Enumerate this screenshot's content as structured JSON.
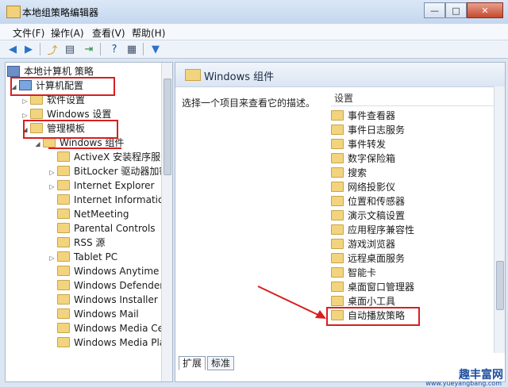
{
  "window": {
    "title": "本地组策略编辑器",
    "min": "—",
    "max": "□",
    "close": "✕"
  },
  "menu": [
    "文件(F)",
    "操作(A)",
    "查看(V)",
    "帮助(H)"
  ],
  "toolbar": [
    "back-icon",
    "forward-icon",
    "up-icon",
    "show-hide-tree-icon",
    "export-icon",
    "help-icon",
    "properties-icon",
    "filter-icon"
  ],
  "tree": [
    {
      "label": "本地计算机 策略",
      "level": 0,
      "icon": "gp",
      "expander": ""
    },
    {
      "label": "计算机配置",
      "level": 1,
      "icon": "pc",
      "expander": "◢"
    },
    {
      "label": "软件设置",
      "level": 2,
      "icon": "folder",
      "expander": "▷"
    },
    {
      "label": "Windows 设置",
      "level": 2,
      "icon": "folder",
      "expander": "▷"
    },
    {
      "label": "管理模板",
      "level": 2,
      "icon": "folder",
      "expander": "◢"
    },
    {
      "label": "Windows 组件",
      "level": 3,
      "icon": "folder",
      "expander": "◢"
    },
    {
      "label": "ActiveX 安装程序服务",
      "level": 4,
      "icon": "folder",
      "expander": ""
    },
    {
      "label": "BitLocker 驱动器加密",
      "level": 4,
      "icon": "folder",
      "expander": "▷"
    },
    {
      "label": "Internet Explorer",
      "level": 4,
      "icon": "folder",
      "expander": "▷"
    },
    {
      "label": "Internet Information",
      "level": 4,
      "icon": "folder",
      "expander": ""
    },
    {
      "label": "NetMeeting",
      "level": 4,
      "icon": "folder",
      "expander": ""
    },
    {
      "label": "Parental Controls",
      "level": 4,
      "icon": "folder",
      "expander": ""
    },
    {
      "label": "RSS 源",
      "level": 4,
      "icon": "folder",
      "expander": ""
    },
    {
      "label": "Tablet PC",
      "level": 4,
      "icon": "folder",
      "expander": "▷"
    },
    {
      "label": "Windows Anytime Up",
      "level": 4,
      "icon": "folder",
      "expander": ""
    },
    {
      "label": "Windows Defender",
      "level": 4,
      "icon": "folder",
      "expander": ""
    },
    {
      "label": "Windows Installer",
      "level": 4,
      "icon": "folder",
      "expander": ""
    },
    {
      "label": "Windows Mail",
      "level": 4,
      "icon": "folder",
      "expander": ""
    },
    {
      "label": "Windows Media Cer",
      "level": 4,
      "icon": "folder",
      "expander": ""
    },
    {
      "label": "Windows Media Play",
      "level": 4,
      "icon": "folder",
      "expander": ""
    }
  ],
  "right": {
    "header": "Windows 组件",
    "description": "选择一个项目来查看它的描述。",
    "column": "设置",
    "items": [
      "事件查看器",
      "事件日志服务",
      "事件转发",
      "数字保险箱",
      "搜索",
      "网络投影仪",
      "位置和传感器",
      "演示文稿设置",
      "应用程序兼容性",
      "游戏浏览器",
      "远程桌面服务",
      "智能卡",
      "桌面窗口管理器",
      "桌面小工具",
      "自动播放策略"
    ]
  },
  "tabs": [
    "扩展",
    "标准"
  ],
  "watermark": {
    "text": "趣丰富网",
    "url": "www.yueyangbang.com"
  },
  "colors": {
    "highlight": "#d81f1f",
    "folder": "#f3d47e",
    "accent": "#1c4e9e"
  }
}
